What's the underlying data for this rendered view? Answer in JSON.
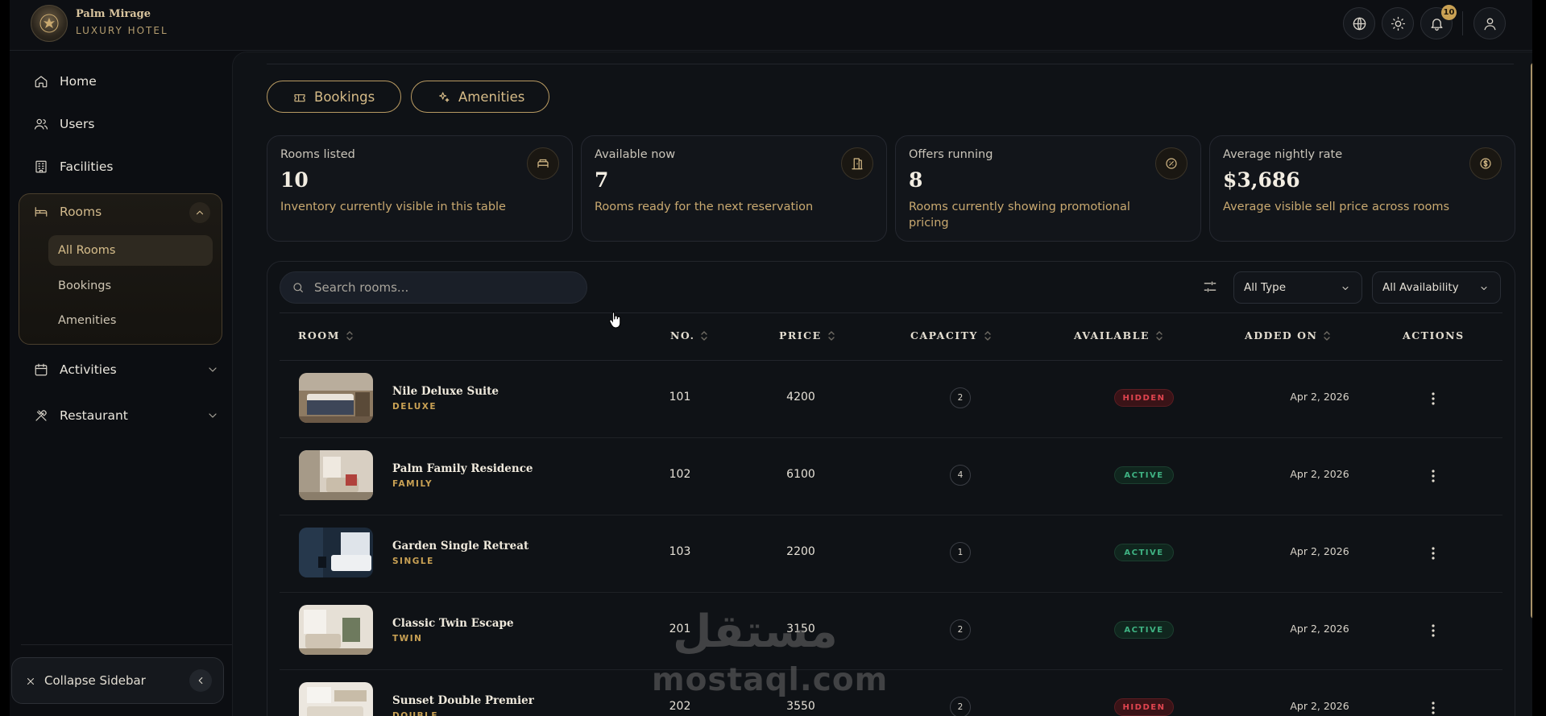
{
  "brand": {
    "name": "Palm Mirage",
    "subtitle": "LUXURY HOTEL"
  },
  "header": {
    "notifications_count": "10",
    "icons": [
      "globe-icon",
      "sun-icon",
      "bell-icon",
      "user-icon"
    ]
  },
  "sidebar": {
    "items": [
      {
        "label": "Home",
        "icon": "home-icon"
      },
      {
        "label": "Users",
        "icon": "users-icon"
      },
      {
        "label": "Facilities",
        "icon": "building-icon"
      }
    ],
    "rooms": {
      "label": "Rooms",
      "icon": "bed-icon",
      "sub_items": [
        {
          "label": "All Rooms",
          "active": true
        },
        {
          "label": "Bookings",
          "active": false
        },
        {
          "label": "Amenities",
          "active": false
        }
      ]
    },
    "more_items": [
      {
        "label": "Activities",
        "icon": "calendar-icon"
      },
      {
        "label": "Restaurant",
        "icon": "utensils-icon"
      }
    ],
    "collapse_label": "Collapse Sidebar"
  },
  "tabs": [
    {
      "label": "Bookings",
      "icon": "ticket-icon"
    },
    {
      "label": "Amenities",
      "icon": "sparkles-icon"
    }
  ],
  "stats": [
    {
      "label": "Rooms listed",
      "value": "10",
      "desc": "Inventory currently visible in this table",
      "icon": "bed-icon"
    },
    {
      "label": "Available now",
      "value": "7",
      "desc": "Rooms ready for the next reservation",
      "icon": "door-icon"
    },
    {
      "label": "Offers running",
      "value": "8",
      "desc": "Rooms currently showing promotional pricing",
      "icon": "percent-badge-icon"
    },
    {
      "label": "Average nightly rate",
      "value": "$3,686",
      "desc": "Average visible sell price across rooms",
      "icon": "dollar-icon"
    }
  ],
  "search": {
    "placeholder": "Search rooms..."
  },
  "filters": {
    "type": "All Type",
    "availability": "All Availability"
  },
  "table": {
    "columns": [
      "ROOM",
      "NO.",
      "PRICE",
      "CAPACITY",
      "AVAILABLE",
      "ADDED ON",
      "ACTIONS"
    ],
    "rows": [
      {
        "name": "Nile Deluxe Suite",
        "type": "DELUXE",
        "no": "101",
        "price": "4200",
        "capacity": "2",
        "status": "HIDDEN",
        "added": "Apr 2, 2026"
      },
      {
        "name": "Palm Family Residence",
        "type": "FAMILY",
        "no": "102",
        "price": "6100",
        "capacity": "4",
        "status": "ACTIVE",
        "added": "Apr 2, 2026"
      },
      {
        "name": "Garden Single Retreat",
        "type": "SINGLE",
        "no": "103",
        "price": "2200",
        "capacity": "1",
        "status": "ACTIVE",
        "added": "Apr 2, 2026"
      },
      {
        "name": "Classic Twin Escape",
        "type": "TWIN",
        "no": "201",
        "price": "3150",
        "capacity": "2",
        "status": "ACTIVE",
        "added": "Apr 2, 2026"
      },
      {
        "name": "Sunset Double Premier",
        "type": "DOUBLE",
        "no": "202",
        "price": "3550",
        "capacity": "2",
        "status": "HIDDEN",
        "added": "Apr 2, 2026"
      }
    ]
  },
  "watermark": {
    "arabic": "مستقل",
    "latin": "mostaql.com"
  },
  "colors": {
    "accent": "#c9a154",
    "background": "#0f1216",
    "hidden": "#e0444f",
    "active": "#3fb383"
  }
}
